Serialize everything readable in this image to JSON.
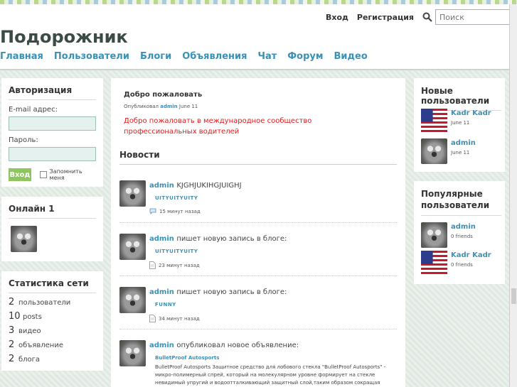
{
  "header": {
    "login_label": "Вход",
    "register_label": "Регистрация",
    "search_placeholder": "Поиск",
    "site_title": "Подорожник",
    "nav": [
      "Главная",
      "Пользователи",
      "Блоги",
      "Объявления",
      "Чат",
      "Форум",
      "Видео"
    ]
  },
  "auth": {
    "title": "Авторизация",
    "email_label": "E-mail адрес:",
    "password_label": "Пароль:",
    "login_button": "Вход",
    "remember_label": "Запомнить меня"
  },
  "online": {
    "title": "Онлайн 1"
  },
  "stats": {
    "title": "Статистика сети",
    "items": [
      {
        "n": "2",
        "label": "пользователи"
      },
      {
        "n": "10",
        "label": "posts"
      },
      {
        "n": "3",
        "label": "видео"
      },
      {
        "n": "2",
        "label": "объявление"
      },
      {
        "n": "2",
        "label": "блога"
      }
    ]
  },
  "welcome": {
    "title": "Добро пожаловать",
    "posted_by": "Опубликовал",
    "author": "admin",
    "date": "June 11",
    "body": "Добро пожаловать в международное сообщество профессиональных водителей"
  },
  "news": {
    "title": "Новости",
    "items": [
      {
        "user": "admin",
        "action": "KJGHJUKIHGJUIGHJ",
        "tag": "UITYUITYUITY",
        "time": "15 минут назад",
        "icon": "comment-icon"
      },
      {
        "user": "admin",
        "action": "пишет новую запись в блоге:",
        "tag": "UITYUITYUITY",
        "time": "23 минут назад",
        "icon": "document-icon"
      },
      {
        "user": "admin",
        "action": "пишет новую запись в блоге:",
        "tag": "FUNNY",
        "time": "34 минут назад",
        "icon": "document-icon"
      },
      {
        "user": "admin",
        "action": "опубликовал новое объявление:",
        "tag": "BulletProof Autosports",
        "text": "BulletProof Autosports Защитное средство для лобового стекла \"BulletProof Autosports\" - микро-полимерный спрей, который на молекулярном уровне формирует на стекле невидимый упругий и водоотталкивающий защитный слой,таким образом сокращая"
      }
    ]
  },
  "new_users": {
    "title": "Новые пользователи",
    "items": [
      {
        "name": "Kadr Kadr",
        "sub": "June 11",
        "pic": "flag"
      },
      {
        "name": "admin",
        "sub": "June 11",
        "pic": "koala"
      }
    ]
  },
  "popular_users": {
    "title": "Популярные пользователи",
    "items": [
      {
        "name": "admin",
        "sub": "0 friends",
        "pic": "koala"
      },
      {
        "name": "Kadr Kadr",
        "sub": "0 friends",
        "pic": "flag"
      }
    ]
  },
  "colors": {
    "link": "#3a91b8",
    "alert": "#e01b1b",
    "button": "#8ec55e"
  }
}
